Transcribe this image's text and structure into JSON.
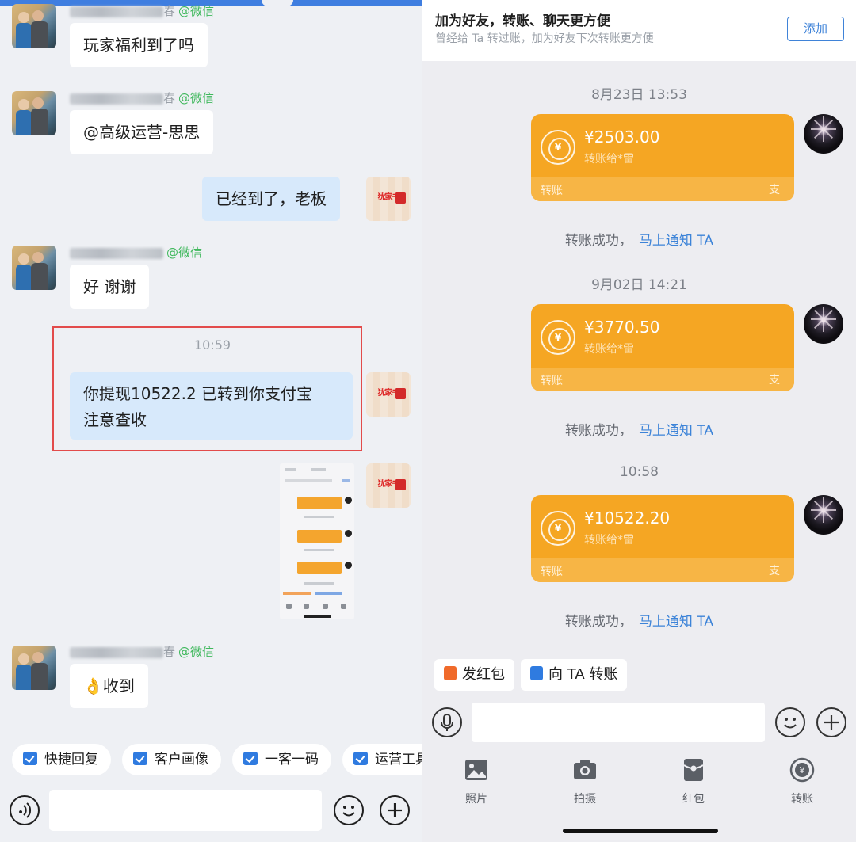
{
  "left_chat": {
    "messages": [
      {
        "sender": "wechat_contact",
        "tag": "@微信",
        "text": "玩家福利到了吗"
      },
      {
        "sender": "wechat_contact",
        "tag": "@微信",
        "text": "@高级运营-思思"
      },
      {
        "sender": "self",
        "text": "已经到了，老板"
      },
      {
        "sender": "wechat_contact",
        "tag": "@微信",
        "text": "好 谢谢"
      },
      {
        "sender": "self",
        "time": "10:59",
        "lines": [
          "你提现10522.2 已转到你支付宝",
          "注意查收"
        ]
      },
      {
        "sender": "self",
        "type": "image"
      },
      {
        "sender": "wechat_contact",
        "tag": "@微信",
        "text": "👌收到"
      }
    ],
    "name_suffixes": [
      "春",
      "春",
      "春"
    ],
    "quick_replies": [
      "快捷回复",
      "客户画像",
      "一客一码",
      "运营工具"
    ]
  },
  "right_chat": {
    "banner": {
      "title": "加为好友，转账、聊天更方便",
      "subtitle": "曾经给 Ta 转过账，加为好友下次转账更方便",
      "add_button": "添加"
    },
    "transfers": [
      {
        "time": "8月23日 13:53",
        "amount": "¥2503.00",
        "recipient": "转账给*雷",
        "footer": "转账",
        "status": "转账成功，",
        "notify": "马上通知 TA"
      },
      {
        "time": "9月02日 14:21",
        "amount": "¥3770.50",
        "recipient": "转账给*雷",
        "footer": "转账",
        "status": "转账成功，",
        "notify": "马上通知 TA"
      },
      {
        "time": "10:58",
        "amount": "¥10522.20",
        "recipient": "转账给*雷",
        "footer": "转账",
        "status": "转账成功，",
        "notify": "马上通知 TA"
      }
    ],
    "actions": [
      {
        "label": "发红包",
        "color": "#f06a2a"
      },
      {
        "label": "向 TA 转账",
        "color": "#2f7be0"
      }
    ],
    "tools": [
      {
        "icon": "photo-icon",
        "label": "照片"
      },
      {
        "icon": "camera-icon",
        "label": "拍摄"
      },
      {
        "icon": "red-packet-icon",
        "label": "红包"
      },
      {
        "icon": "transfer-icon",
        "label": "转账"
      }
    ],
    "colors": {
      "transfer_card": "#f5a623",
      "link": "#3c83d8"
    }
  }
}
